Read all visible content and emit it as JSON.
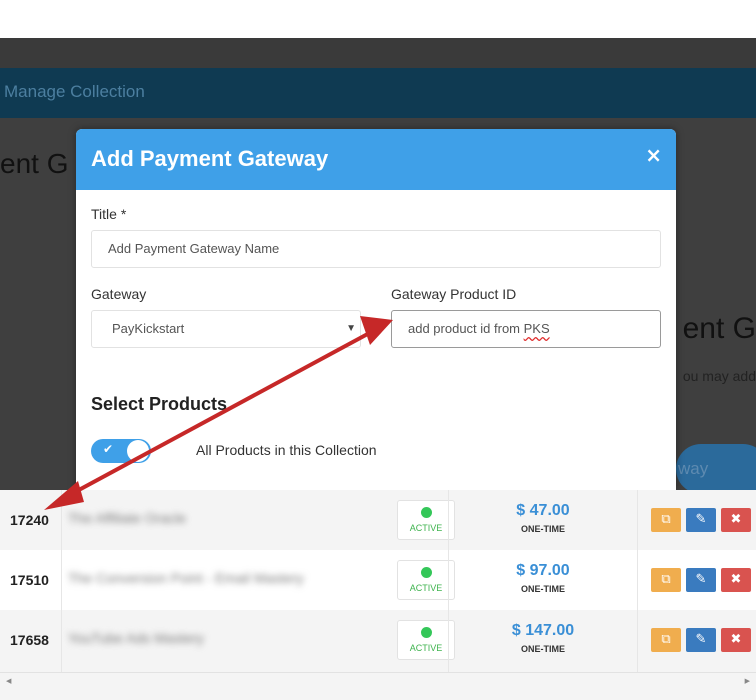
{
  "background": {
    "nav_text": "Manage Collection",
    "page_title_fragment": "ent G",
    "page_title_fragment_right": "ent G",
    "subtitle_fragment": "ou may add",
    "button_fragment": "way"
  },
  "modal": {
    "title": "Add Payment Gateway",
    "close_label": "×",
    "title_label": "Title *",
    "title_placeholder": "Add Payment Gateway Name",
    "gateway_label": "Gateway",
    "gateway_value": "PayKickstart",
    "product_id_label": "Gateway Product ID",
    "product_id_value_prefix": "add product id from ",
    "product_id_value_suffix": "PKS",
    "select_products_title": "Select Products",
    "toggle_label": "All Products in this Collection",
    "toggle_on": true
  },
  "table": {
    "rows": [
      {
        "id": "17240",
        "name": "The Affiliate Oracle",
        "status": "ACTIVE",
        "price": "$ 47.00",
        "price_type": "ONE-TIME"
      },
      {
        "id": "17510",
        "name": "The Conversion Point - Email Mastery",
        "status": "ACTIVE",
        "price": "$ 97.00",
        "price_type": "ONE-TIME"
      },
      {
        "id": "17658",
        "name": "YouTube Ads Mastery",
        "status": "ACTIVE",
        "price": "$ 147.00",
        "price_type": "ONE-TIME"
      }
    ]
  },
  "colors": {
    "modal_header": "#3fa0e8",
    "status_green": "#34c759",
    "price_blue": "#3a8fd6",
    "copy_btn": "#f0ad4e",
    "edit_btn": "#3a7bbf",
    "delete_btn": "#d9534f",
    "annotation_arrow": "#c62828"
  },
  "icons": {
    "close": "close-icon",
    "copy": "copy-icon",
    "edit": "pencil-icon",
    "delete": "x-icon",
    "toggle": "check-icon"
  }
}
